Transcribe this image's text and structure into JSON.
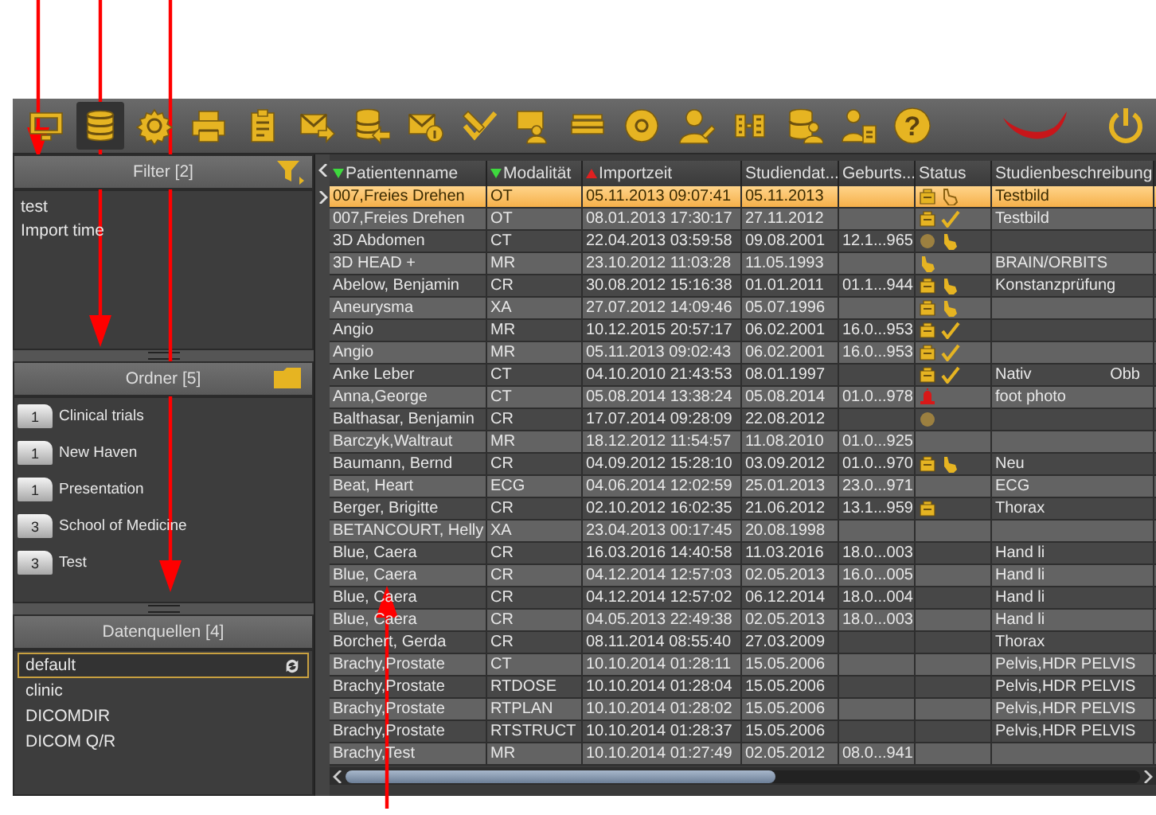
{
  "toolbar": {
    "items": [
      {
        "kind": "monitor",
        "selected": false
      },
      {
        "kind": "database",
        "selected": true
      },
      {
        "kind": "gear",
        "selected": false
      },
      {
        "kind": "printer",
        "selected": false
      },
      {
        "kind": "clipboard",
        "selected": false
      },
      {
        "kind": "mail-send",
        "selected": false
      },
      {
        "kind": "database-import",
        "selected": false
      },
      {
        "kind": "mail-info",
        "selected": false
      },
      {
        "kind": "pen-check",
        "selected": false
      },
      {
        "kind": "screen-person",
        "selected": false
      },
      {
        "kind": "scanner",
        "selected": false
      },
      {
        "kind": "disc",
        "selected": false
      },
      {
        "kind": "person-pen",
        "selected": false
      },
      {
        "kind": "film",
        "selected": false
      },
      {
        "kind": "database-person",
        "selected": false
      },
      {
        "kind": "person-clipboard",
        "selected": false
      },
      {
        "kind": "help",
        "selected": false,
        "glyph": "?"
      }
    ]
  },
  "sidebar": {
    "filter": {
      "title": "Filter [2]",
      "items": [
        "test",
        "Import time"
      ]
    },
    "folders": {
      "title": "Ordner [5]",
      "items": [
        {
          "count": "1",
          "name": "Clinical trials"
        },
        {
          "count": "1",
          "name": "New Haven"
        },
        {
          "count": "1",
          "name": "Presentation"
        },
        {
          "count": "3",
          "name": "School of Medicine"
        },
        {
          "count": "3",
          "name": "Test"
        }
      ]
    },
    "sources": {
      "title": "Datenquellen [4]",
      "items": [
        {
          "name": "default",
          "selected": true
        },
        {
          "name": "clinic",
          "selected": false
        },
        {
          "name": "DICOMDIR",
          "selected": false
        },
        {
          "name": "DICOM Q/R",
          "selected": false
        }
      ]
    }
  },
  "table": {
    "columns": [
      {
        "label": "Patientenname",
        "sorted": true,
        "descending": true
      },
      {
        "label": "Modalität",
        "sorted": true,
        "descending": true
      },
      {
        "label": "Importzeit",
        "sorted": true,
        "descending": false
      },
      {
        "label": "Studiendat...",
        "sorted": false
      },
      {
        "label": "Geburts...",
        "sorted": false
      },
      {
        "label": "Status",
        "sorted": false
      },
      {
        "label": "Studienbeschreibung",
        "sorted": false
      }
    ],
    "rows": [
      {
        "selected": true,
        "cells": [
          "007,Freies Drehen",
          "OT",
          "05.11.2013 09:07:41",
          "05.11.2013",
          ""
        ],
        "status": [
          {
            "kind": "box"
          },
          {
            "kind": "hand-outline"
          }
        ],
        "description": "Testbild"
      },
      {
        "selected": false,
        "cells": [
          "007,Freies Drehen",
          "OT",
          "08.01.2013 17:30:17",
          "27.11.2012",
          ""
        ],
        "status": [
          {
            "kind": "box"
          },
          {
            "kind": "check"
          }
        ],
        "description": "Testbild"
      },
      {
        "selected": false,
        "cells": [
          "3D Abdomen",
          "CT",
          "22.04.2013 03:59:58",
          "09.08.2001",
          "12.1...965"
        ],
        "status": [
          {
            "kind": "dot"
          },
          {
            "kind": "hand"
          }
        ],
        "description": ""
      },
      {
        "selected": false,
        "cells": [
          "3D HEAD +",
          "MR",
          "23.10.2012 11:03:28",
          "11.05.1993",
          ""
        ],
        "status": [
          {
            "kind": "hand"
          }
        ],
        "description": "BRAIN/ORBITS"
      },
      {
        "selected": false,
        "cells": [
          "Abelow, Benjamin",
          "CR",
          "30.08.2012 15:16:38",
          "01.01.2011",
          "01.1...944"
        ],
        "status": [
          {
            "kind": "box"
          },
          {
            "kind": "hand"
          }
        ],
        "description": "Konstanzprüfung"
      },
      {
        "selected": false,
        "cells": [
          "Aneurysma",
          "XA",
          "27.07.2012 14:09:46",
          "05.07.1996",
          ""
        ],
        "status": [
          {
            "kind": "box"
          },
          {
            "kind": "hand"
          }
        ],
        "description": ""
      },
      {
        "selected": false,
        "cells": [
          "Angio",
          "MR",
          "10.12.2015 20:57:17",
          "06.02.2001",
          "16.0...953"
        ],
        "status": [
          {
            "kind": "box"
          },
          {
            "kind": "check"
          }
        ],
        "description": ""
      },
      {
        "selected": false,
        "cells": [
          "Angio",
          "MR",
          "05.11.2013 09:02:43",
          "06.02.2001",
          "16.0...953"
        ],
        "status": [
          {
            "kind": "box"
          },
          {
            "kind": "check"
          }
        ],
        "description": ""
      },
      {
        "selected": false,
        "cells": [
          "Anke Leber",
          "CT",
          "04.10.2010 21:43:53",
          "08.01.1997",
          ""
        ],
        "status": [
          {
            "kind": "box"
          },
          {
            "kind": "check"
          }
        ],
        "description": "Nativ",
        "description_extra": "Obb"
      },
      {
        "selected": false,
        "cells": [
          "Anna,George",
          "CT",
          "05.08.2014 13:38:24",
          "05.08.2014",
          "01.0...978"
        ],
        "status": [
          {
            "kind": "alarm"
          }
        ],
        "description": "foot photo"
      },
      {
        "selected": false,
        "cells": [
          "Balthasar, Benjamin",
          "CR",
          "17.07.2014 09:28:09",
          "22.08.2012",
          ""
        ],
        "status": [
          {
            "kind": "dot"
          }
        ],
        "description": ""
      },
      {
        "selected": false,
        "cells": [
          "Barczyk,Waltraut",
          "MR",
          "18.12.2012 11:54:57",
          "11.08.2010",
          "01.0...925"
        ],
        "status": [],
        "description": ""
      },
      {
        "selected": false,
        "cells": [
          "Baumann, Bernd",
          "CR",
          "04.09.2012 15:28:10",
          "03.09.2012",
          "01.0...970"
        ],
        "status": [
          {
            "kind": "box"
          },
          {
            "kind": "hand"
          }
        ],
        "description": "Neu"
      },
      {
        "selected": false,
        "cells": [
          "Beat, Heart",
          "ECG",
          "04.06.2014 12:02:59",
          "25.01.2013",
          "23.0...971"
        ],
        "status": [],
        "description": "ECG"
      },
      {
        "selected": false,
        "cells": [
          "Berger, Brigitte",
          "CR",
          "02.10.2012 16:02:35",
          "21.06.2012",
          "13.1...959"
        ],
        "status": [
          {
            "kind": "box"
          }
        ],
        "description": "Thorax"
      },
      {
        "selected": false,
        "cells": [
          "BETANCOURT, Helly",
          "XA",
          "23.04.2013 00:17:45",
          "20.08.1998",
          ""
        ],
        "status": [],
        "description": ""
      },
      {
        "selected": false,
        "cells": [
          "Blue, Caera",
          "CR",
          "16.03.2016 14:40:58",
          "11.03.2016",
          "18.0...003"
        ],
        "status": [],
        "description": "Hand li"
      },
      {
        "selected": false,
        "cells": [
          "Blue, Caera",
          "CR",
          "04.12.2014 12:57:03",
          "02.05.2013",
          "16.0...005"
        ],
        "status": [],
        "description": "Hand li"
      },
      {
        "selected": false,
        "cells": [
          "Blue, Caera",
          "CR",
          "04.12.2014 12:57:02",
          "06.12.2014",
          "18.0...004"
        ],
        "status": [],
        "description": "Hand li"
      },
      {
        "selected": false,
        "cells": [
          "Blue, Caera",
          "CR",
          "04.05.2013 22:49:38",
          "02.05.2013",
          "18.0...003"
        ],
        "status": [],
        "description": "Hand li"
      },
      {
        "selected": false,
        "cells": [
          "Borchert, Gerda",
          "CR",
          "08.11.2014 08:55:40",
          "27.03.2009",
          ""
        ],
        "status": [],
        "description": "Thorax"
      },
      {
        "selected": false,
        "cells": [
          "Brachy,Prostate",
          "CT",
          "10.10.2014 01:28:11",
          "15.05.2006",
          ""
        ],
        "status": [],
        "description": "Pelvis,HDR PELVIS"
      },
      {
        "selected": false,
        "cells": [
          "Brachy,Prostate",
          "RTDOSE",
          "10.10.2014 01:28:04",
          "15.05.2006",
          ""
        ],
        "status": [],
        "description": "Pelvis,HDR PELVIS"
      },
      {
        "selected": false,
        "cells": [
          "Brachy,Prostate",
          "RTPLAN",
          "10.10.2014 01:28:02",
          "15.05.2006",
          ""
        ],
        "status": [],
        "description": "Pelvis,HDR PELVIS"
      },
      {
        "selected": false,
        "cells": [
          "Brachy,Prostate",
          "RTSTRUCT",
          "10.10.2014 01:28:37",
          "15.05.2006",
          ""
        ],
        "status": [],
        "description": "Pelvis,HDR PELVIS"
      },
      {
        "selected": false,
        "cells": [
          "Brachy,Test",
          "MR",
          "10.10.2014 01:27:49",
          "02.05.2012",
          "08.0...941"
        ],
        "status": [],
        "description": ""
      }
    ]
  }
}
